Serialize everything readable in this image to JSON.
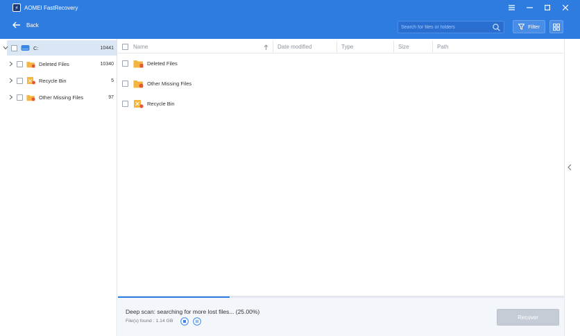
{
  "app": {
    "title": "AOMEI FastRecovery",
    "logo_icon": "lightning-icon"
  },
  "window_controls": [
    "menu-icon",
    "minimize-icon",
    "maximize-icon",
    "close-icon"
  ],
  "toolbar": {
    "back_label": "Back",
    "search_placeholder": "Search for files or folders",
    "filter_label": "Filter",
    "view_toggle_icon": "grid-view-icon"
  },
  "sidebar": {
    "items": [
      {
        "label": "C:",
        "count": "10441",
        "icon": "drive-icon",
        "selected": true,
        "expanded": true
      },
      {
        "label": "Deleted Files",
        "count": "10340",
        "icon": "deleted-folder-icon"
      },
      {
        "label": "Recycle Bin",
        "count": "5",
        "icon": "recycle-bin-icon"
      },
      {
        "label": "Other Missing Files",
        "count": "97",
        "icon": "missing-folder-icon"
      }
    ]
  },
  "table": {
    "columns": [
      "Name",
      "Date modified",
      "Type",
      "Size",
      "Path"
    ],
    "sort_column": "Name",
    "sort_direction": "ascending",
    "rows": [
      {
        "name": "Deleted Files",
        "icon": "deleted-folder-icon"
      },
      {
        "name": "Other Missing Files",
        "icon": "missing-folder-icon"
      },
      {
        "name": "Recycle Bin",
        "icon": "recycle-bin-icon"
      }
    ]
  },
  "status": {
    "scan_text": "Deep scan: searching for more lost files... (25.00%)",
    "progress": 0.25,
    "found_text": "File(s) found : 1.14 GB",
    "recover_label": "Recover"
  },
  "colors": {
    "accent": "#2f7ce0",
    "folder": "#f4b63f",
    "badge": "#e8563a",
    "recover_disabled": "#c6ccd5"
  }
}
